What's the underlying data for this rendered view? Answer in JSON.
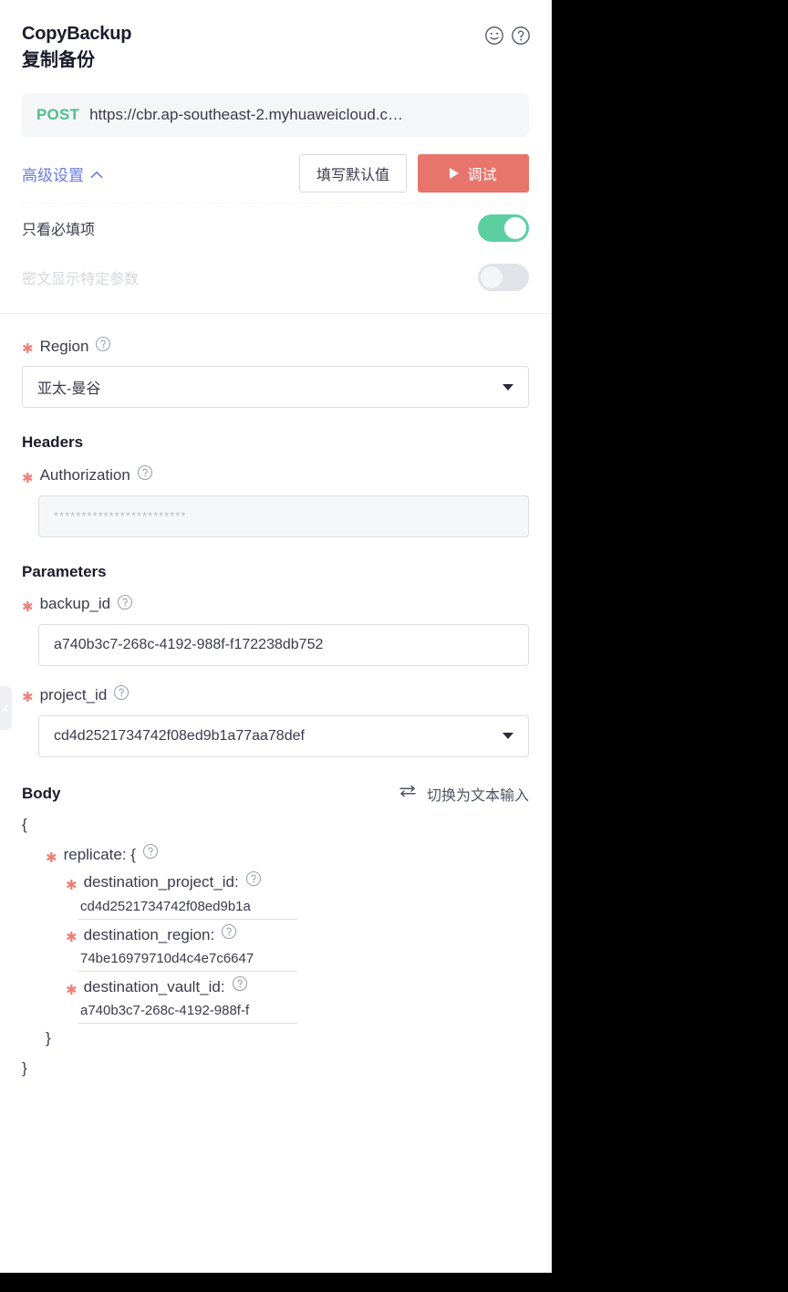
{
  "header": {
    "title_en": "CopyBackup",
    "title_cn": "复制备份",
    "smile_icon": "smiley-icon",
    "help_icon": "question-circle-icon"
  },
  "request": {
    "method": "POST",
    "url": "https://cbr.ap-southeast-2.myhuaweicloud.c…"
  },
  "actions": {
    "advanced_label": "高级设置",
    "advanced_caret": "⌃",
    "fill_defaults_label": "填写默认值",
    "debug_label": "调试"
  },
  "advanced": {
    "required_only": {
      "label": "只看必填项",
      "state": "on"
    },
    "mask_params": {
      "label": "密文显示特定参数",
      "state": "off"
    }
  },
  "region": {
    "label": "Region",
    "value": "亚太-曼谷"
  },
  "headers": {
    "section_title": "Headers",
    "authorization": {
      "label": "Authorization",
      "value": "************************"
    }
  },
  "parameters": {
    "section_title": "Parameters",
    "backup_id": {
      "label": "backup_id",
      "value": "a740b3c7-268c-4192-988f-f172238db752"
    },
    "project_id": {
      "label": "project_id",
      "value": "cd4d2521734742f08ed9b1a77aa78def"
    }
  },
  "body": {
    "section_title": "Body",
    "switch_label": "切换为文本输入",
    "switch_icon": "swap-arrows-icon",
    "open_brace": "{",
    "close_brace": "}",
    "replicate": {
      "key": "replicate: {",
      "close": "}",
      "fields": [
        {
          "key": "destination_project_id:",
          "value": "cd4d2521734742f08ed9b1a"
        },
        {
          "key": "destination_region:",
          "value": "74be16979710d4c4e7c6647"
        },
        {
          "key": "destination_vault_id:",
          "value": "a740b3c7-268c-4192-988f-f"
        }
      ]
    }
  },
  "colors": {
    "accent_red": "#e8756b",
    "link_blue": "#6b7ce0",
    "method_green": "#4ec08a",
    "toggle_green": "#5bcfa0",
    "required_star": "#ef8079"
  }
}
